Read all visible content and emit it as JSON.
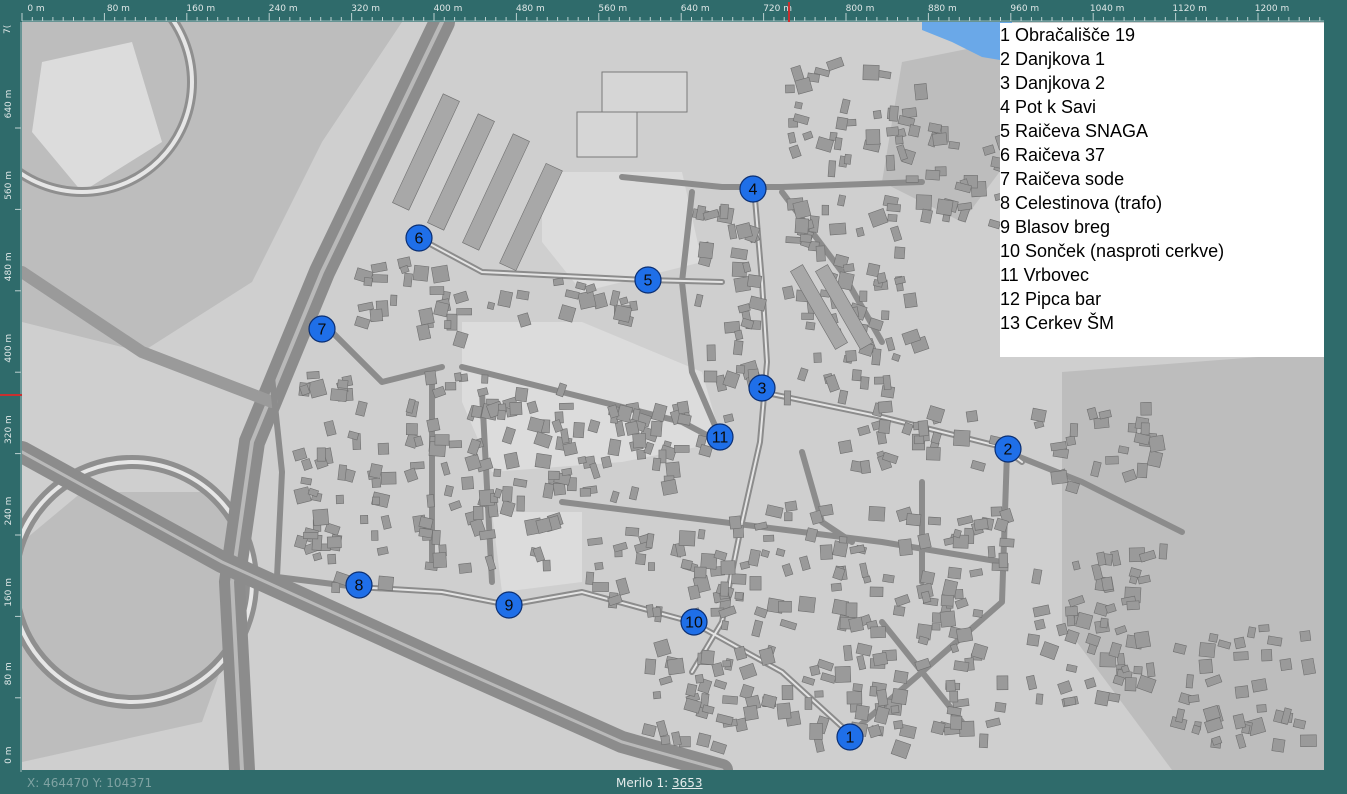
{
  "ruler_top": {
    "labels": [
      "0 m",
      "80 m",
      "160 m",
      "240 m",
      "320 m",
      "400 m",
      "480 m",
      "560 m",
      "640 m",
      "720 m",
      "800 m",
      "880 m",
      "960 m",
      "1040 m",
      "1120 m",
      "1200 m"
    ]
  },
  "ruler_left": {
    "labels": [
      "640 m",
      "560 m",
      "480 m",
      "400 m",
      "320 m",
      "240 m",
      "160 m",
      "80 m",
      "0 m"
    ],
    "top_fragment": "7("
  },
  "legend": {
    "items": [
      "1 Obračališče 19",
      "2 Danjkova 1",
      "3 Danjkova 2",
      "4 Pot k Savi",
      "5 Raičeva SNAGA",
      "6 Raičeva 37",
      "7 Raičeva sode",
      "8 Celestinova (trafo)",
      "9 Blasov breg",
      "10 Sonček (nasproti cerkve)",
      "11 Vrbovec",
      "12 Pipca bar",
      "13 Cerkev ŠM"
    ]
  },
  "markers": [
    {
      "label": "1",
      "name": "marker-1-obracalisce-19"
    },
    {
      "label": "2",
      "name": "marker-2-danjkova-1"
    },
    {
      "label": "3",
      "name": "marker-3-danjkova-2"
    },
    {
      "label": "4",
      "name": "marker-4-pot-k-savi"
    },
    {
      "label": "5",
      "name": "marker-5-raiceva-snaga"
    },
    {
      "label": "6",
      "name": "marker-6-raiceva-37"
    },
    {
      "label": "7",
      "name": "marker-7-raiceva-sode"
    },
    {
      "label": "8",
      "name": "marker-8-celestinova-trafo"
    },
    {
      "label": "9",
      "name": "marker-9-blasov-breg"
    },
    {
      "label": "10",
      "name": "marker-10-soncek"
    },
    {
      "label": "11",
      "name": "marker-11-vrbovec"
    }
  ],
  "status": {
    "coords": "X: 464470 Y: 104371",
    "scale_label": "Merilo 1:",
    "scale_value": "3653"
  },
  "colors": {
    "frame": "#2f6b6b",
    "land": "#cfcfcf",
    "road": "#8c8c8c",
    "building": "#9a9a9a",
    "marker": "#1f6fe8",
    "water": "#6aa8e8"
  }
}
